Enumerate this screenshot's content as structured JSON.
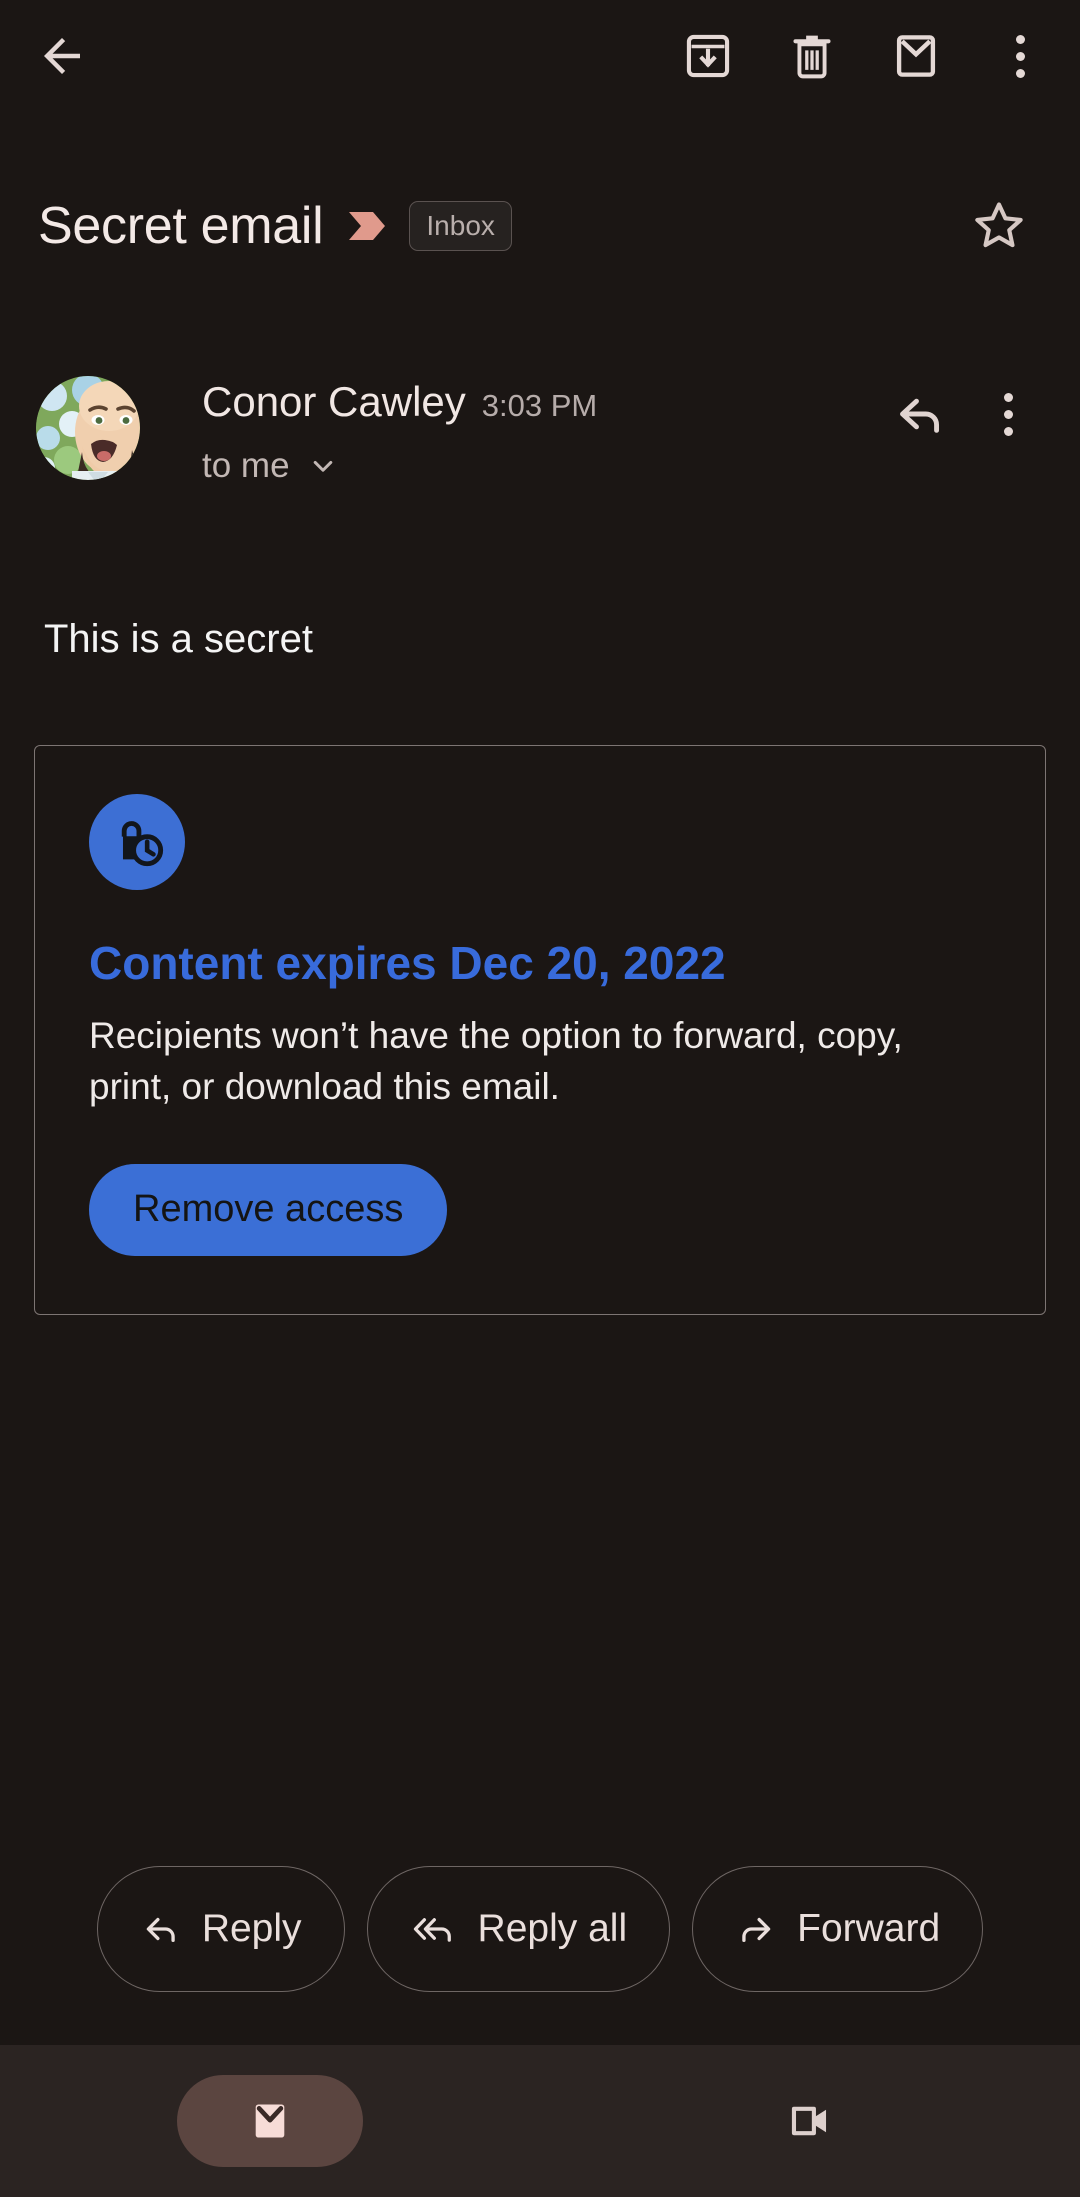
{
  "app": {
    "theme": "dark",
    "background": "#1b1614",
    "accent_blue": "#386bdb",
    "accent_salmon": "#e09a8c",
    "nav_active_bg": "#5b4540"
  },
  "appbar": {
    "back_label": "Back",
    "icons": [
      {
        "name": "archive-icon",
        "label": "Archive"
      },
      {
        "name": "delete-icon",
        "label": "Delete"
      },
      {
        "name": "mark-unread-icon",
        "label": "Mark as unread"
      },
      {
        "name": "more-options-icon",
        "label": "More options"
      }
    ]
  },
  "thread": {
    "subject": "Secret email",
    "marker_icon": "importance-marker-icon",
    "label_chip": "Inbox",
    "star_label": "Star",
    "starred": false
  },
  "message": {
    "sender_name": "Conor Cawley",
    "time": "3:03 PM",
    "recipients": "to me",
    "expand_details_icon": "chevron-down-icon",
    "reply_icon": "reply-icon",
    "more_icon": "more-options-icon",
    "body": "This is a secret"
  },
  "confidential_card": {
    "icon": "lock-clock-icon",
    "title": "Content expires Dec 20, 2022",
    "description": "Recipients won’t have the option to forward, copy, print, or download this email.",
    "button_label": "Remove access"
  },
  "actions": [
    {
      "name": "reply-button",
      "label": "Reply",
      "icon": "reply-icon"
    },
    {
      "name": "reply-all-button",
      "label": "Reply all",
      "icon": "reply-all-icon"
    },
    {
      "name": "forward-button",
      "label": "Forward",
      "icon": "forward-icon"
    }
  ],
  "bottom_nav": [
    {
      "name": "nav-mail",
      "icon": "mail-icon",
      "active": true
    },
    {
      "name": "nav-meet",
      "icon": "video-camera-icon",
      "active": false
    }
  ]
}
